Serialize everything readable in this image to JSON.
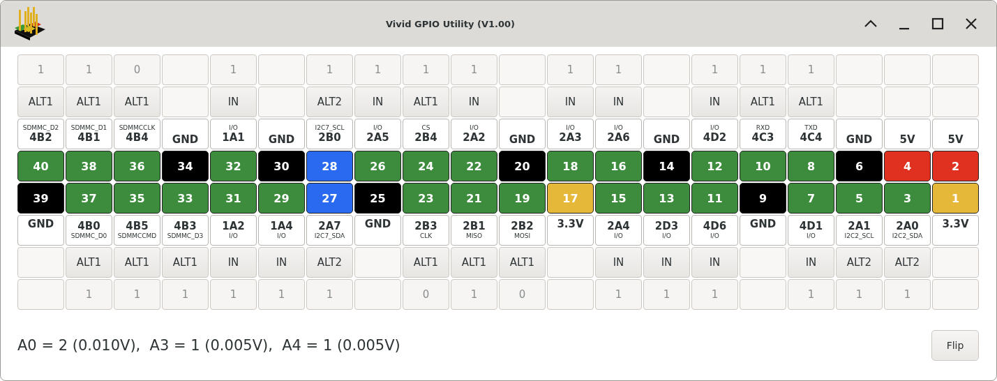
{
  "window": {
    "title": "Vivid GPIO Utility (V1.00)"
  },
  "top_row": [
    {
      "value": "1",
      "mode": "ALT1",
      "func": "SDMMC_D2",
      "name": "4B2",
      "pin": "40",
      "color": "#3d8c3d"
    },
    {
      "value": "1",
      "mode": "ALT1",
      "func": "SDMMC_D1",
      "name": "4B1",
      "pin": "38",
      "color": "#3d8c3d"
    },
    {
      "value": "0",
      "mode": "ALT1",
      "func": "SDMMCCLK",
      "name": "4B4",
      "pin": "36",
      "color": "#3d8c3d"
    },
    {
      "name": "GND",
      "pin": "34",
      "color": "#000000"
    },
    {
      "value": "1",
      "mode": "IN",
      "func": "I/O",
      "name": "1A1",
      "pin": "32",
      "color": "#3d8c3d"
    },
    {
      "name": "GND",
      "pin": "30",
      "color": "#000000"
    },
    {
      "value": "1",
      "mode": "ALT2",
      "func": "I2C7_SCL",
      "name": "2B0",
      "pin": "28",
      "color": "#2a6af0"
    },
    {
      "value": "1",
      "mode": "IN",
      "func": "I/O",
      "name": "2A5",
      "pin": "26",
      "color": "#3d8c3d"
    },
    {
      "value": "1",
      "mode": "ALT1",
      "func": "CS",
      "name": "2B4",
      "pin": "24",
      "color": "#3d8c3d"
    },
    {
      "value": "1",
      "mode": "IN",
      "func": "I/O",
      "name": "2A2",
      "pin": "22",
      "color": "#3d8c3d"
    },
    {
      "name": "GND",
      "pin": "20",
      "color": "#000000"
    },
    {
      "value": "1",
      "mode": "IN",
      "func": "I/O",
      "name": "2A3",
      "pin": "18",
      "color": "#3d8c3d"
    },
    {
      "value": "1",
      "mode": "IN",
      "func": "I/O",
      "name": "2A6",
      "pin": "16",
      "color": "#3d8c3d"
    },
    {
      "name": "GND",
      "pin": "14",
      "color": "#000000"
    },
    {
      "value": "1",
      "mode": "IN",
      "func": "I/O",
      "name": "4D2",
      "pin": "12",
      "color": "#3d8c3d"
    },
    {
      "value": "1",
      "mode": "ALT1",
      "func": "RXD",
      "name": "4C3",
      "pin": "10",
      "color": "#3d8c3d"
    },
    {
      "value": "1",
      "mode": "ALT1",
      "func": "TXD",
      "name": "4C4",
      "pin": "8",
      "color": "#3d8c3d"
    },
    {
      "name": "GND",
      "pin": "6",
      "color": "#000000"
    },
    {
      "name": "5V",
      "pin": "4",
      "color": "#e03020"
    },
    {
      "name": "5V",
      "pin": "2",
      "color": "#e03020"
    }
  ],
  "bottom_row": [
    {
      "name": "GND",
      "pin": "39",
      "color": "#000000"
    },
    {
      "value": "1",
      "mode": "ALT1",
      "func": "SDMMC_D0",
      "name": "4B0",
      "pin": "37",
      "color": "#3d8c3d"
    },
    {
      "value": "1",
      "mode": "ALT1",
      "func": "SDMMCCMD",
      "name": "4B5",
      "pin": "35",
      "color": "#3d8c3d"
    },
    {
      "value": "1",
      "mode": "ALT1",
      "func": "SDMMC_D3",
      "name": "4B3",
      "pin": "33",
      "color": "#3d8c3d"
    },
    {
      "value": "1",
      "mode": "IN",
      "func": "I/O",
      "name": "1A2",
      "pin": "31",
      "color": "#3d8c3d"
    },
    {
      "value": "1",
      "mode": "IN",
      "func": "I/O",
      "name": "1A4",
      "pin": "29",
      "color": "#3d8c3d"
    },
    {
      "value": "1",
      "mode": "ALT2",
      "func": "I2C7_SDA",
      "name": "2A7",
      "pin": "27",
      "color": "#2a6af0"
    },
    {
      "name": "GND",
      "pin": "25",
      "color": "#000000"
    },
    {
      "value": "0",
      "mode": "ALT1",
      "func": "CLK",
      "name": "2B3",
      "pin": "23",
      "color": "#3d8c3d"
    },
    {
      "value": "1",
      "mode": "ALT1",
      "func": "MISO",
      "name": "2B1",
      "pin": "21",
      "color": "#3d8c3d"
    },
    {
      "value": "0",
      "mode": "ALT1",
      "func": "MOSI",
      "name": "2B2",
      "pin": "19",
      "color": "#3d8c3d"
    },
    {
      "name": "3.3V",
      "pin": "17",
      "color": "#e6b83a"
    },
    {
      "value": "1",
      "mode": "IN",
      "func": "I/O",
      "name": "2A4",
      "pin": "15",
      "color": "#3d8c3d"
    },
    {
      "value": "1",
      "mode": "IN",
      "func": "I/O",
      "name": "2D3",
      "pin": "13",
      "color": "#3d8c3d"
    },
    {
      "value": "1",
      "mode": "IN",
      "func": "I/O",
      "name": "4D6",
      "pin": "11",
      "color": "#3d8c3d"
    },
    {
      "name": "GND",
      "pin": "9",
      "color": "#000000"
    },
    {
      "value": "1",
      "mode": "IN",
      "func": "I/O",
      "name": "4D1",
      "pin": "7",
      "color": "#3d8c3d"
    },
    {
      "value": "1",
      "mode": "ALT2",
      "func": "I2C2_SCL",
      "name": "2A1",
      "pin": "5",
      "color": "#3d8c3d"
    },
    {
      "value": "1",
      "mode": "ALT2",
      "func": "I2C2_SDA",
      "name": "2A0",
      "pin": "3",
      "color": "#3d8c3d"
    },
    {
      "name": "3.3V",
      "pin": "1",
      "color": "#e6b83a"
    }
  ],
  "status": "A0 = 2 (0.010V),  A3 = 1 (0.005V),  A4 = 1 (0.005V)",
  "buttons": [
    "Flip"
  ]
}
